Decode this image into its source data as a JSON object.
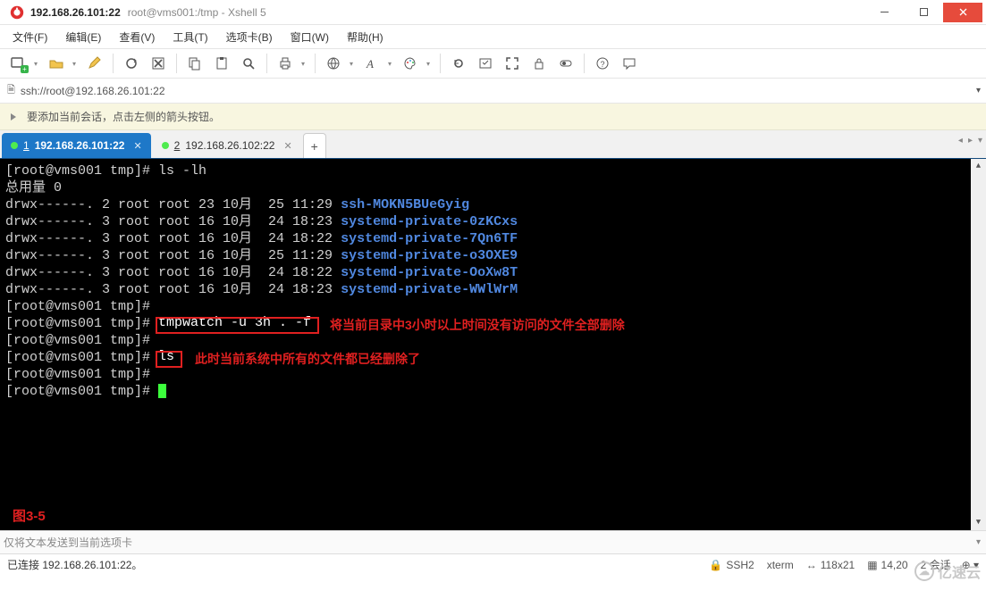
{
  "title": {
    "ip": "192.168.26.101:22",
    "sub": "root@vms001:/tmp - Xshell 5"
  },
  "menu": [
    "文件(F)",
    "编辑(E)",
    "查看(V)",
    "工具(T)",
    "选项卡(B)",
    "窗口(W)",
    "帮助(H)"
  ],
  "toolbar_icons": [
    "new-session-icon",
    "open-icon",
    "edit-icon",
    "reconnect-icon",
    "disconnect-icon",
    "copy-icon",
    "paste-icon",
    "search-icon",
    "print-icon",
    "globe-icon",
    "font-style-icon",
    "palette-icon",
    "retry-icon",
    "quick-icon",
    "fullscreen-icon",
    "lock-icon",
    "toggle-icon",
    "help-icon",
    "speech-icon"
  ],
  "addr": {
    "lock": "🔒",
    "url": "ssh://root@192.168.26.101:22"
  },
  "hint": {
    "icon": "💡",
    "text": "要添加当前会话，点击左侧的箭头按钮。"
  },
  "tabs": {
    "active": {
      "num": "1",
      "label": "192.168.26.101:22"
    },
    "inactive": {
      "num": "2",
      "label": "192.168.26.102:22"
    }
  },
  "terminal": {
    "cmd_ls": "[root@vms001 tmp]# ls -lh",
    "total": "总用量 0",
    "rows": [
      {
        "perm": "drwx------.",
        "n": "2",
        "u": "root",
        "g": "root",
        "sz": "23",
        "mon": "10月",
        "day": "25",
        "time": "11:29",
        "name": "ssh-MOKN5BUeGyig"
      },
      {
        "perm": "drwx------.",
        "n": "3",
        "u": "root",
        "g": "root",
        "sz": "16",
        "mon": "10月",
        "day": "24",
        "time": "18:23",
        "name": "systemd-private-0zKCxs"
      },
      {
        "perm": "drwx------.",
        "n": "3",
        "u": "root",
        "g": "root",
        "sz": "16",
        "mon": "10月",
        "day": "24",
        "time": "18:22",
        "name": "systemd-private-7Qn6TF"
      },
      {
        "perm": "drwx------.",
        "n": "3",
        "u": "root",
        "g": "root",
        "sz": "16",
        "mon": "10月",
        "day": "25",
        "time": "11:29",
        "name": "systemd-private-o3OXE9"
      },
      {
        "perm": "drwx------.",
        "n": "3",
        "u": "root",
        "g": "root",
        "sz": "16",
        "mon": "10月",
        "day": "24",
        "time": "18:22",
        "name": "systemd-private-OoXw8T"
      },
      {
        "perm": "drwx------.",
        "n": "3",
        "u": "root",
        "g": "root",
        "sz": "16",
        "mon": "10月",
        "day": "24",
        "time": "18:23",
        "name": "systemd-private-WWlWrM"
      }
    ],
    "prompt_plain": "[root@vms001 tmp]#",
    "prompt_sp": "[root@vms001 tmp]# ",
    "cmd_tmp": "tmpwatch -u 3h . -f",
    "note_tmp": "将当前目录中3小时以上时间没有访问的文件全部删除",
    "cmd_ls2": "ls",
    "note_ls": "此时当前系统中所有的文件都已经删除了",
    "figure": "图3-5"
  },
  "sendbar": {
    "placeholder": "仅将文本发送到当前选项卡"
  },
  "status": {
    "conn": "已连接 192.168.26.101:22。",
    "proto": "SSH2",
    "term": "xterm",
    "size": "118x21",
    "pos": "14,20",
    "sessions": "2 会话"
  },
  "watermark": "亿速云"
}
